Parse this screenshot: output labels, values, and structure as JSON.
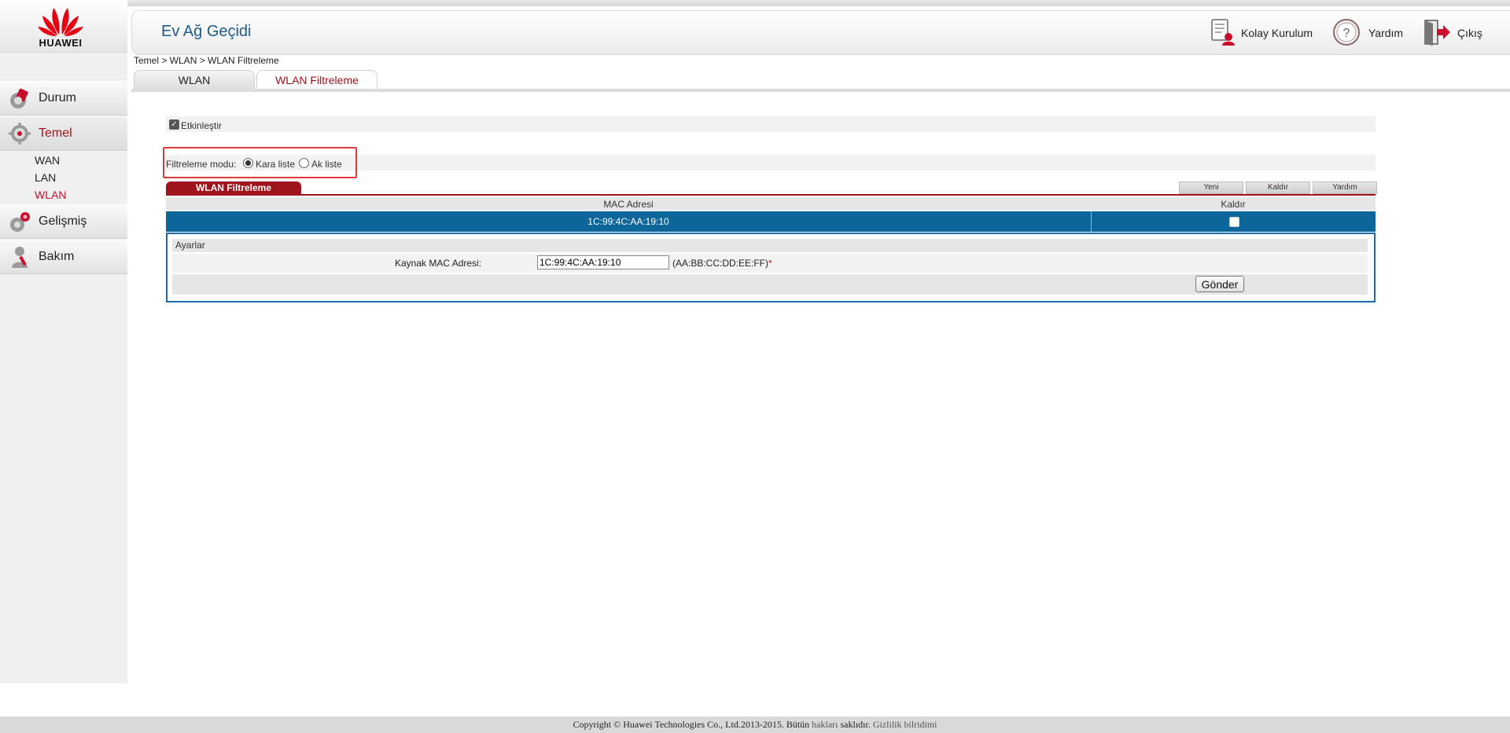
{
  "brand": {
    "logo_text": "HUAWEI",
    "accent": "#c8102e"
  },
  "header": {
    "title": "Ev Ağ Geçidi",
    "easy_setup_label": "Kolay Kurulum",
    "help_label": "Yardım",
    "logout_label": "Çıkış"
  },
  "sidebar": {
    "items": [
      {
        "label": "Durum",
        "icon": "status-icon"
      },
      {
        "label": "Temel",
        "icon": "basic-settings-icon",
        "active": true
      },
      {
        "label": "Gelişmiş",
        "icon": "advanced-icon"
      },
      {
        "label": "Bakım",
        "icon": "maintenance-icon"
      }
    ],
    "sub_items": [
      {
        "label": "WAN"
      },
      {
        "label": "LAN"
      },
      {
        "label": "WLAN",
        "active": true
      }
    ]
  },
  "breadcrumb": "Temel > WLAN > WLAN Filtreleme",
  "tabs": [
    {
      "label": "WLAN"
    },
    {
      "label": "WLAN Filtreleme",
      "active": true
    }
  ],
  "filter": {
    "enable_label": "Etkinleştir",
    "enable_checked": true,
    "mode_label": "Filtreleme modu:",
    "mode_options": [
      {
        "label": "Kara liste",
        "selected": true
      },
      {
        "label": "Ak liste",
        "selected": false
      }
    ]
  },
  "list": {
    "section_title": "WLAN Filtreleme",
    "buttons": {
      "new": "Yeni",
      "remove": "Kaldır",
      "help": "Yardım"
    },
    "columns": [
      "MAC Adresi",
      "Kaldır"
    ],
    "rows": [
      {
        "mac": "1C:99:4C:AA:19:10",
        "remove_checked": false
      }
    ]
  },
  "settings": {
    "title": "Ayarlar",
    "source_mac_label": "Kaynak MAC Adresi:",
    "source_mac_value": "1C:99:4C:AA:19:10",
    "format_hint": "(AA:BB:CC:DD:EE:FF)",
    "required_mark": "*",
    "submit_label": "Gönder"
  },
  "footer": {
    "copyright": "Copyright © Huawei Technologies Co., Ltd.2013-2015. Bütün ",
    "rights_link": "hakları",
    "reserved": " saklıdır. ",
    "privacy_link": "Gizlilik bilridimi"
  }
}
